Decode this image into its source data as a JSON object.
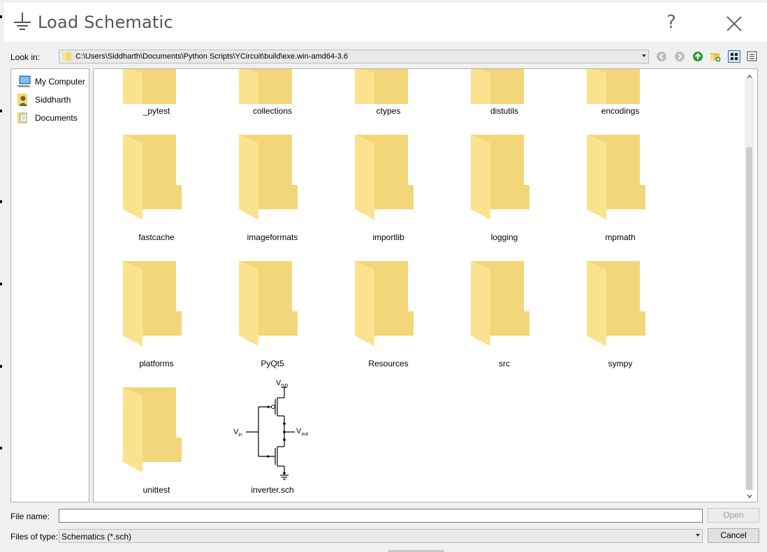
{
  "window": {
    "title": "Load Schematic",
    "help_label": "?",
    "title_icon": "ground-icon",
    "close_icon": "close-icon"
  },
  "look_in": {
    "label": "Look in:",
    "path": "C:\\Users\\Siddharth\\Documents\\Python Scripts\\YCircuit\\build\\exe.win-amd64-3.6"
  },
  "toolbar": {
    "buttons": [
      "back-icon",
      "forward-icon",
      "parent-directory-icon",
      "new-folder-icon",
      "list-view-icon",
      "detail-view-icon"
    ]
  },
  "sidebar": {
    "items": [
      {
        "label": "My Computer",
        "icon": "computer-icon"
      },
      {
        "label": "Siddharth",
        "icon": "user-icon"
      },
      {
        "label": "Documents",
        "icon": "documents-icon"
      }
    ]
  },
  "files": {
    "items": [
      {
        "name": "_pytest",
        "type": "folder"
      },
      {
        "name": "collections",
        "type": "folder"
      },
      {
        "name": "ctypes",
        "type": "folder"
      },
      {
        "name": "distutils",
        "type": "folder"
      },
      {
        "name": "encodings",
        "type": "folder"
      },
      {
        "name": "fastcache",
        "type": "folder"
      },
      {
        "name": "imageformats",
        "type": "folder"
      },
      {
        "name": "importlib",
        "type": "folder"
      },
      {
        "name": "logging",
        "type": "folder"
      },
      {
        "name": "mpmath",
        "type": "folder"
      },
      {
        "name": "platforms",
        "type": "folder"
      },
      {
        "name": "PyQt5",
        "type": "folder"
      },
      {
        "name": "Resources",
        "type": "folder"
      },
      {
        "name": "src",
        "type": "folder"
      },
      {
        "name": "sympy",
        "type": "folder"
      },
      {
        "name": "unittest",
        "type": "folder"
      },
      {
        "name": "inverter.sch",
        "type": "schematic"
      }
    ],
    "schematic_thumbnail": {
      "vdd": "V",
      "vdd_sub": "DD",
      "vin": "V",
      "vin_sub": "in",
      "vout": "V",
      "vout_sub": "out"
    }
  },
  "file_name": {
    "label": "File name:",
    "value": "",
    "open_label": "Open"
  },
  "file_type": {
    "label": "Files of type:",
    "value": "Schematics (*.sch)",
    "cancel_label": "Cancel"
  },
  "colors": {
    "folder_back": "#f3d67a",
    "folder_front": "#fbe28e",
    "accent": "#3c6ea8"
  }
}
